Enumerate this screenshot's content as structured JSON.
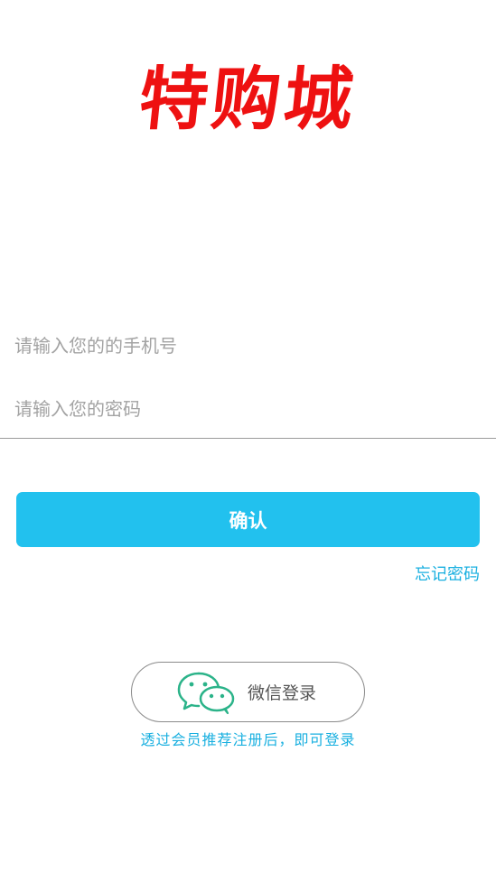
{
  "app": {
    "logo_text": "特购城"
  },
  "login_form": {
    "phone_placeholder": "请输入您的的手机号",
    "phone_value": "",
    "password_placeholder": "请输入您的密码",
    "password_value": "",
    "confirm_label": "确认",
    "forgot_password_label": "忘记密码"
  },
  "wechat_login": {
    "label": "微信登录",
    "icon": "wechat-icon",
    "hint": "透过会员推荐注册后，即可登录"
  },
  "colors": {
    "logo": "#ee1111",
    "accent": "#22c1ee",
    "link": "#1ab0e0",
    "wechat_green": "#2bb389"
  }
}
